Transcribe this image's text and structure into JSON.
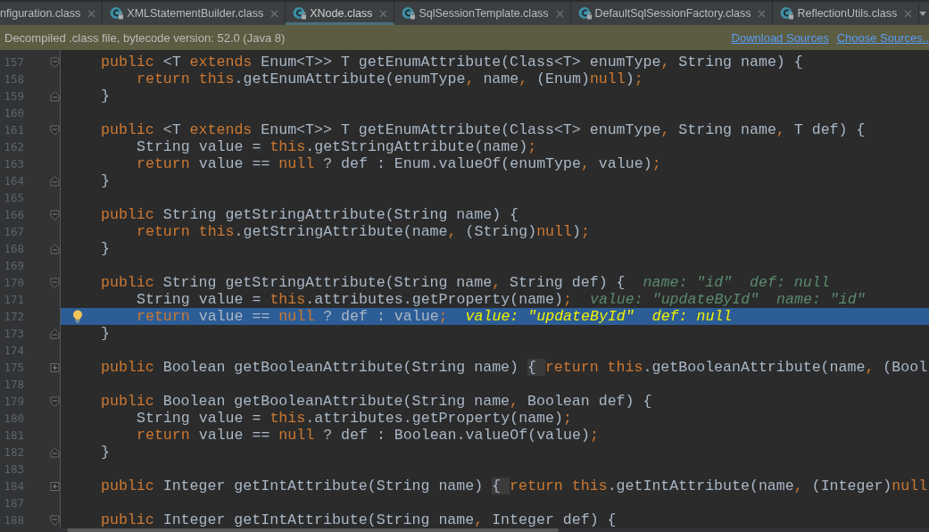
{
  "tabs": [
    {
      "label": "nfiguration.class",
      "icon": false,
      "selected": false
    },
    {
      "label": "XMLStatementBuilder.class",
      "icon": true,
      "selected": false
    },
    {
      "label": "XNode.class",
      "icon": true,
      "selected": true
    },
    {
      "label": "SqlSessionTemplate.class",
      "icon": true,
      "selected": false
    },
    {
      "label": "DefaultSqlSessionFactory.class",
      "icon": true,
      "selected": false
    },
    {
      "label": "ReflectionUtils.class",
      "icon": true,
      "selected": false
    }
  ],
  "banner": {
    "message": "Decompiled .class file, bytecode version: 52.0 (Java 8)",
    "links": [
      "Download Sources",
      "Choose Sources.."
    ]
  },
  "lines": [
    {
      "n": "157",
      "kind": "open",
      "current": false,
      "code": [
        {
          "kind": "kw",
          "text": "public"
        },
        {
          "kind": "p",
          "text": " <T "
        },
        {
          "kind": "kw",
          "text": "extends"
        },
        {
          "kind": "p",
          "text": " Enum<T>> T getEnumAttribute(Class<T> enumType"
        },
        {
          "kind": "kw",
          "text": ","
        },
        {
          "kind": "p",
          "text": " String name) {"
        }
      ],
      "children": [
        {
          "n": "158",
          "current": false,
          "code": [
            {
              "kind": "kw",
              "text": "return this"
            },
            {
              "kind": "p",
              "text": ".getEnumAttribute(enumType"
            },
            {
              "kind": "kw",
              "text": ","
            },
            {
              "kind": "p",
              "text": " name"
            },
            {
              "kind": "kw",
              "text": ","
            },
            {
              "kind": "p",
              "text": " (Enum)"
            },
            {
              "kind": "kw",
              "text": "null"
            },
            {
              "kind": "p",
              "text": ")"
            },
            {
              "kind": "kw",
              "text": ";"
            }
          ]
        }
      ]
    },
    {
      "n": "159",
      "kind": "close",
      "current": false,
      "code": [
        {
          "kind": "p",
          "text": "}"
        }
      ]
    },
    {
      "n": "160",
      "current": false
    },
    {
      "n": "161",
      "kind": "open",
      "current": false,
      "code": [
        {
          "kind": "kw",
          "text": "public"
        },
        {
          "kind": "p",
          "text": " <T "
        },
        {
          "kind": "kw",
          "text": "extends"
        },
        {
          "kind": "p",
          "text": " Enum<T>> T getEnumAttribute(Class<T> enumType"
        },
        {
          "kind": "kw",
          "text": ","
        },
        {
          "kind": "p",
          "text": " String name"
        },
        {
          "kind": "kw",
          "text": ","
        },
        {
          "kind": "p",
          "text": " T def) {"
        }
      ],
      "children": [
        {
          "n": "162",
          "current": false,
          "code": [
            {
              "kind": "p",
              "text": "String value = "
            },
            {
              "kind": "kw",
              "text": "this"
            },
            {
              "kind": "p",
              "text": ".getStringAttribute(name)"
            },
            {
              "kind": "kw",
              "text": ";"
            }
          ]
        },
        {
          "n": "163",
          "current": false,
          "code": [
            {
              "kind": "kw",
              "text": "return"
            },
            {
              "kind": "p",
              "text": " value == "
            },
            {
              "kind": "kw",
              "text": "null"
            },
            {
              "kind": "p",
              "text": " ? def : Enum.valueOf(enumType"
            },
            {
              "kind": "kw",
              "text": ","
            },
            {
              "kind": "p",
              "text": " value)"
            },
            {
              "kind": "kw",
              "text": ";"
            }
          ]
        }
      ]
    },
    {
      "n": "164",
      "kind": "close",
      "current": false,
      "code": [
        {
          "kind": "p",
          "text": "}"
        }
      ]
    },
    {
      "n": "165",
      "current": false
    },
    {
      "n": "166",
      "kind": "open",
      "current": false,
      "code": [
        {
          "kind": "kw",
          "text": "public"
        },
        {
          "kind": "p",
          "text": " String getStringAttribute(String name) {"
        }
      ],
      "children": [
        {
          "n": "167",
          "current": false,
          "code": [
            {
              "kind": "kw",
              "text": "return this"
            },
            {
              "kind": "p",
              "text": ".getStringAttribute(name"
            },
            {
              "kind": "kw",
              "text": ","
            },
            {
              "kind": "p",
              "text": " (String)"
            },
            {
              "kind": "kw",
              "text": "null"
            },
            {
              "kind": "p",
              "text": ")"
            },
            {
              "kind": "kw",
              "text": ";"
            }
          ]
        }
      ]
    },
    {
      "n": "168",
      "kind": "close",
      "current": false,
      "code": [
        {
          "kind": "p",
          "text": "}"
        }
      ]
    },
    {
      "n": "169",
      "current": false
    },
    {
      "n": "170",
      "kind": "open",
      "current": false,
      "code": [
        {
          "kind": "kw",
          "text": "public"
        },
        {
          "kind": "p",
          "text": " String getStringAttribute(String name"
        },
        {
          "kind": "kw",
          "text": ","
        },
        {
          "kind": "p",
          "text": " String def) {"
        }
      ],
      "hint": "name: \"id\"  def: null",
      "children": [
        {
          "n": "171",
          "current": false,
          "code": [
            {
              "kind": "p",
              "text": "String value = "
            },
            {
              "kind": "kw",
              "text": "this"
            },
            {
              "kind": "p",
              "text": ".attributes.getProperty(name)"
            },
            {
              "kind": "kw",
              "text": ";"
            }
          ],
          "hint": "value: \"updateById\"  name: \"id\""
        },
        {
          "n": "172",
          "current": true,
          "bulb": true,
          "code": [
            {
              "kind": "kw",
              "text": "return"
            },
            {
              "kind": "p",
              "text": " value == "
            },
            {
              "kind": "kw",
              "text": "null"
            },
            {
              "kind": "p",
              "text": " ? def : value"
            },
            {
              "kind": "kw",
              "text": ";"
            }
          ],
          "hint": "value: \"updateById\"  def: null"
        }
      ]
    },
    {
      "n": "173",
      "kind": "close",
      "current": false,
      "code": [
        {
          "kind": "p",
          "text": "}"
        }
      ]
    },
    {
      "n": "174",
      "current": false
    },
    {
      "n": "175",
      "kind": "collapsed",
      "current": false,
      "code": [
        {
          "kind": "kw",
          "text": "public"
        },
        {
          "kind": "p",
          "text": " Boolean getBooleanAttribute(String name) "
        },
        {
          "kind": "fold",
          "text": "{ "
        },
        {
          "kind": "kw",
          "text": "return this"
        },
        {
          "kind": "p",
          "text": ".getBooleanAttribute(name"
        },
        {
          "kind": "kw",
          "text": ","
        },
        {
          "kind": "p",
          "text": " (Bool"
        }
      ]
    },
    {
      "n": "178",
      "current": false
    },
    {
      "n": "179",
      "kind": "open",
      "current": false,
      "code": [
        {
          "kind": "kw",
          "text": "public"
        },
        {
          "kind": "p",
          "text": " Boolean getBooleanAttribute(String name"
        },
        {
          "kind": "kw",
          "text": ","
        },
        {
          "kind": "p",
          "text": " Boolean def) {"
        }
      ],
      "children": [
        {
          "n": "180",
          "current": false,
          "code": [
            {
              "kind": "p",
              "text": "String value = "
            },
            {
              "kind": "kw",
              "text": "this"
            },
            {
              "kind": "p",
              "text": ".attributes.getProperty(name)"
            },
            {
              "kind": "kw",
              "text": ";"
            }
          ]
        },
        {
          "n": "181",
          "current": false,
          "code": [
            {
              "kind": "kw",
              "text": "return"
            },
            {
              "kind": "p",
              "text": " value == "
            },
            {
              "kind": "kw",
              "text": "null"
            },
            {
              "kind": "p",
              "text": " ? def : Boolean.valueOf(value)"
            },
            {
              "kind": "kw",
              "text": ";"
            }
          ]
        }
      ]
    },
    {
      "n": "182",
      "kind": "close",
      "current": false,
      "code": [
        {
          "kind": "p",
          "text": "}"
        }
      ]
    },
    {
      "n": "183",
      "current": false
    },
    {
      "n": "184",
      "kind": "collapsed",
      "current": false,
      "code": [
        {
          "kind": "kw",
          "text": "public"
        },
        {
          "kind": "p",
          "text": " Integer getIntAttribute(String name) "
        },
        {
          "kind": "fold",
          "text": "{ "
        },
        {
          "kind": "kw",
          "text": "return this"
        },
        {
          "kind": "p",
          "text": ".getIntAttribute(name"
        },
        {
          "kind": "kw",
          "text": ","
        },
        {
          "kind": "p",
          "text": " (Integer)"
        },
        {
          "kind": "kw",
          "text": "null"
        }
      ]
    },
    {
      "n": "187",
      "current": false
    },
    {
      "n": "188",
      "kind": "open",
      "current": false,
      "code": [
        {
          "kind": "kw",
          "text": "public"
        },
        {
          "kind": "p",
          "text": " Integer getIntAttribute(String name"
        },
        {
          "kind": "kw",
          "text": ","
        },
        {
          "kind": "p",
          "text": " Integer def) {"
        }
      ]
    }
  ]
}
